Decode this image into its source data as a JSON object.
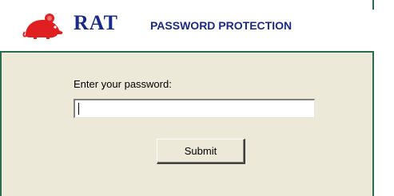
{
  "header": {
    "app_name": "RAT",
    "subtitle": "PASSWORD PROTECTION",
    "logo_icon": "rat-icon"
  },
  "form": {
    "prompt": "Enter your password:",
    "password_value": "",
    "submit_label": "Submit"
  },
  "colors": {
    "brand_red": "#e02020",
    "title_blue": "#1a2a8a",
    "rule_green": "#2b6b4f",
    "panel_bg": "#ede9d9"
  }
}
